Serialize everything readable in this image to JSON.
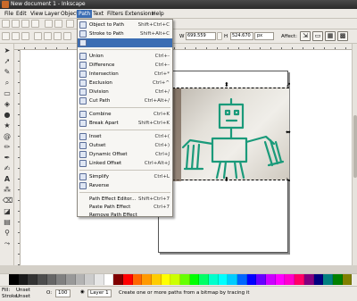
{
  "window": {
    "title": "New document 1 - Inkscape"
  },
  "menubar": {
    "items": [
      "File",
      "Edit",
      "View",
      "Layer",
      "Object",
      "Path",
      "Text",
      "Filters",
      "Extensions",
      "Help"
    ],
    "active": "Path"
  },
  "tool_controls": {
    "w_label": "W",
    "w_value": "699.559",
    "h_label": "H",
    "h_value": "524.670",
    "unit": "px",
    "affect_label": "Affect:"
  },
  "path_menu": {
    "items": [
      {
        "label": "Object to Path",
        "shortcut": "Shift+Ctrl+C",
        "highlighted": false
      },
      {
        "label": "Stroke to Path",
        "shortcut": "Shift+Alt+C",
        "highlighted": false
      },
      {
        "label": "",
        "shortcut": "",
        "highlighted": true
      },
      {
        "label": "Union",
        "shortcut": "Ctrl+-",
        "highlighted": false
      },
      {
        "label": "Difference",
        "shortcut": "Ctrl+-",
        "highlighted": false
      },
      {
        "label": "Intersection",
        "shortcut": "Ctrl+*",
        "highlighted": false
      },
      {
        "label": "Exclusion",
        "shortcut": "Ctrl+^",
        "highlighted": false
      },
      {
        "label": "Division",
        "shortcut": "Ctrl+/",
        "highlighted": false
      },
      {
        "label": "Cut Path",
        "shortcut": "Ctrl+Alt+/",
        "highlighted": false
      },
      {
        "label": "Combine",
        "shortcut": "Ctrl+K",
        "highlighted": false
      },
      {
        "label": "Break Apart",
        "shortcut": "Shift+Ctrl+K",
        "highlighted": false
      },
      {
        "label": "Inset",
        "shortcut": "Ctrl+(",
        "highlighted": false
      },
      {
        "label": "Outset",
        "shortcut": "Ctrl+)",
        "highlighted": false
      },
      {
        "label": "Dynamic Offset",
        "shortcut": "Ctrl+J",
        "highlighted": false
      },
      {
        "label": "Linked Offset",
        "shortcut": "Ctrl+Alt+J",
        "highlighted": false
      },
      {
        "label": "Simplify",
        "shortcut": "Ctrl+L",
        "highlighted": false
      },
      {
        "label": "Reverse",
        "shortcut": "",
        "highlighted": false
      },
      {
        "label": "Path Effect Editor...",
        "shortcut": "Shift+Ctrl+7",
        "highlighted": false
      },
      {
        "label": "Paste Path Effect",
        "shortcut": "Ctrl+7",
        "highlighted": false
      },
      {
        "label": "Remove Path Effect",
        "shortcut": "",
        "highlighted": false
      }
    ]
  },
  "status": {
    "fill_label": "Fill:",
    "fill_value": "Unset",
    "stroke_label": "Stroke:",
    "stroke_value": "Unset",
    "opacity_label": "O:",
    "opacity_value": "100",
    "layer": "Layer 1",
    "message": "Create one or more paths from a bitmap by tracing it"
  },
  "palette": {
    "colors": [
      "#000000",
      "#1a1a1a",
      "#333333",
      "#4d4d4d",
      "#666666",
      "#808080",
      "#999999",
      "#b3b3b3",
      "#cccccc",
      "#e6e6e6",
      "#ffffff",
      "#800000",
      "#ff0000",
      "#ff6600",
      "#ff9900",
      "#ffcc00",
      "#ffff00",
      "#ccff00",
      "#66ff00",
      "#00ff00",
      "#00ff66",
      "#00ffcc",
      "#00ffff",
      "#00ccff",
      "#0066ff",
      "#0000ff",
      "#6600ff",
      "#cc00ff",
      "#ff00ff",
      "#ff00cc",
      "#ff0066",
      "#800080",
      "#000080",
      "#008080",
      "#008000",
      "#808000"
    ]
  }
}
